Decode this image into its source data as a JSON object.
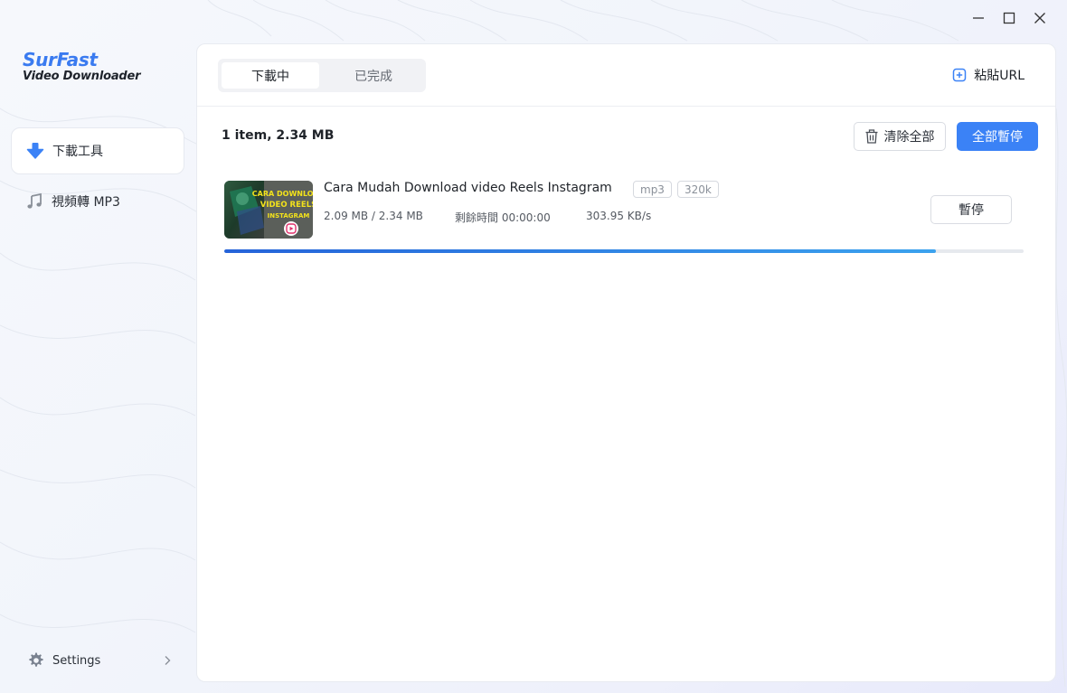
{
  "app": {
    "logo_title": "SurFast",
    "logo_subtitle": "Video Downloader"
  },
  "sidebar": {
    "items": [
      {
        "label": "下載工具",
        "icon": "download-arrow-icon",
        "active": true
      },
      {
        "label": "視頻轉 MP3",
        "icon": "music-note-icon",
        "active": false
      }
    ],
    "settings_label": "Settings"
  },
  "topbar": {
    "tabs": [
      {
        "label": "下載中",
        "active": true
      },
      {
        "label": "已完成",
        "active": false
      }
    ],
    "paste_url_label": "粘貼URL"
  },
  "toolbar": {
    "summary": "1 item, 2.34 MB",
    "clear_all_label": "清除全部",
    "pause_all_label": "全部暫停"
  },
  "downloads": [
    {
      "title": "Cara Mudah Download video Reels Instagram",
      "format": "mp3",
      "bitrate": "320k",
      "size_progress": "2.09 MB / 2.34 MB",
      "remaining": "剩餘時間 00:00:00",
      "speed": "303.95 KB/s",
      "progress_fraction": 0.89,
      "pause_label": "暫停",
      "thumbnail_text": [
        "CARA DOWNLOAD",
        "VIDEO REELS",
        "INSTAGRAM"
      ]
    }
  ],
  "colors": {
    "accent": "#3b82f6",
    "logo_blue": "#3a7bf0",
    "progress_start": "#2563d9",
    "progress_end": "#3ba2ee"
  }
}
